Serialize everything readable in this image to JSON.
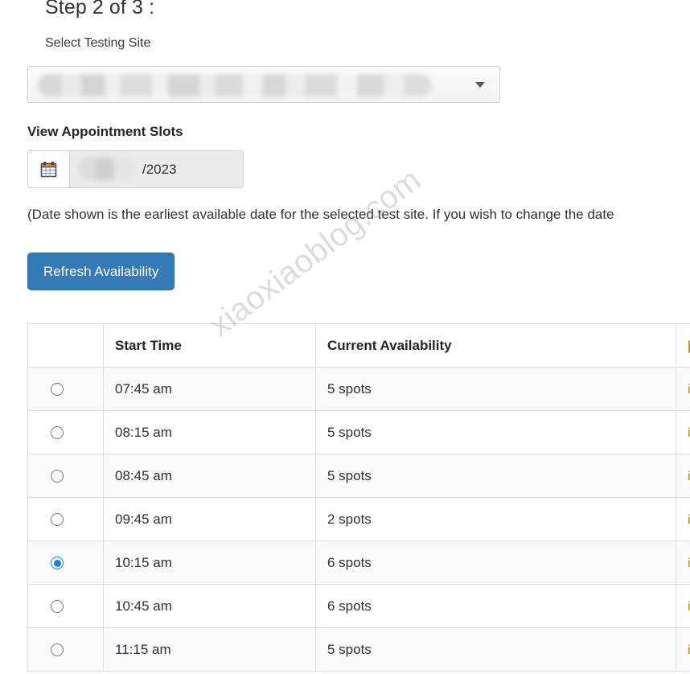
{
  "step": {
    "heading": "Step 2 of 3 :",
    "site_label": "Select Testing Site"
  },
  "site_select": {
    "value": "",
    "caret_icon": "chevron-down-icon"
  },
  "appointment": {
    "section_title": "View Appointment Slots",
    "calendar_icon": "calendar-icon",
    "date_value": "/2023",
    "note": "(Date shown is the earliest available date for the selected test site. If you wish to change the date",
    "refresh_label": "Refresh Availability"
  },
  "table": {
    "columns": [
      "",
      "Start Time",
      "Current Availability",
      ""
    ],
    "rows": [
      {
        "selected": false,
        "start_time": "07:45 am",
        "availability": "5 spots",
        "extra": "i"
      },
      {
        "selected": false,
        "start_time": "08:15 am",
        "availability": "5 spots",
        "extra": "i"
      },
      {
        "selected": false,
        "start_time": "08:45 am",
        "availability": "5 spots",
        "extra": "i"
      },
      {
        "selected": false,
        "start_time": "09:45 am",
        "availability": "2 spots",
        "extra": "i"
      },
      {
        "selected": true,
        "start_time": "10:15 am",
        "availability": "6 spots",
        "extra": "i"
      },
      {
        "selected": false,
        "start_time": "10:45 am",
        "availability": "6 spots",
        "extra": "i"
      },
      {
        "selected": false,
        "start_time": "11:15 am",
        "availability": "5 spots",
        "extra": "i"
      }
    ]
  },
  "watermark": {
    "text": "xiaoxiaoblog.com"
  },
  "colors": {
    "primary_button": "#337ab7",
    "radio_selected": "#1b7ced",
    "table_border": "#dddddd",
    "stripe": "#f9f9f9",
    "extra_text": "#b8860b"
  }
}
